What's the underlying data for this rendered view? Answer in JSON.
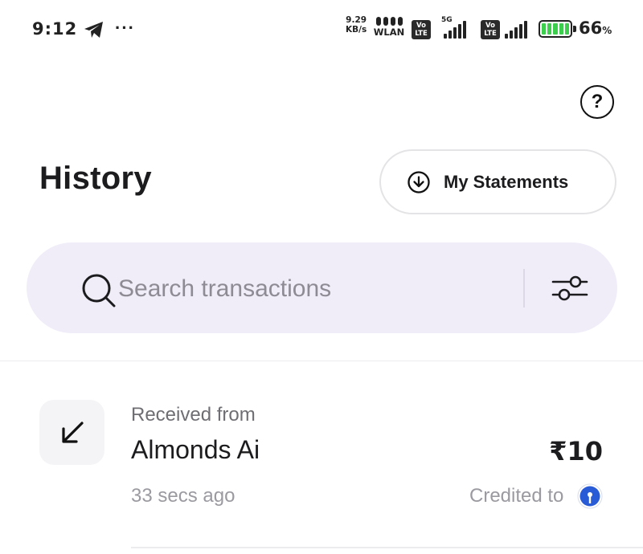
{
  "status_bar": {
    "time": "9:12",
    "net_speed_value": "9.29",
    "net_speed_unit": "KB/s",
    "wlan_label": "WLAN",
    "volte_label_1": "Vo LTE",
    "network_5g": "5G",
    "volte_label_2": "Vo LTE",
    "battery_level": 66,
    "battery_percent": "66",
    "battery_percent_sign": "%",
    "icons": [
      "telegram-icon",
      "more-dots-icon",
      "wifi-icon",
      "signal-icon",
      "battery-icon"
    ]
  },
  "header": {
    "title": "History",
    "statements_label": "My Statements",
    "help_icon": "help-circle-icon"
  },
  "search": {
    "placeholder": "Search transactions",
    "value": ""
  },
  "transactions": [
    {
      "type_label": "Received from",
      "name": "Almonds Ai",
      "amount": "₹10",
      "time": "33 secs ago",
      "credited_label": "Credited to",
      "direction_icon": "arrow-down-left-icon",
      "bank_icon": "bank-logo-icon"
    }
  ],
  "colors": {
    "search_bg": "#f0edf9",
    "battery_fill": "#3ccf4e",
    "bank_logo": "#2a5bd7"
  }
}
